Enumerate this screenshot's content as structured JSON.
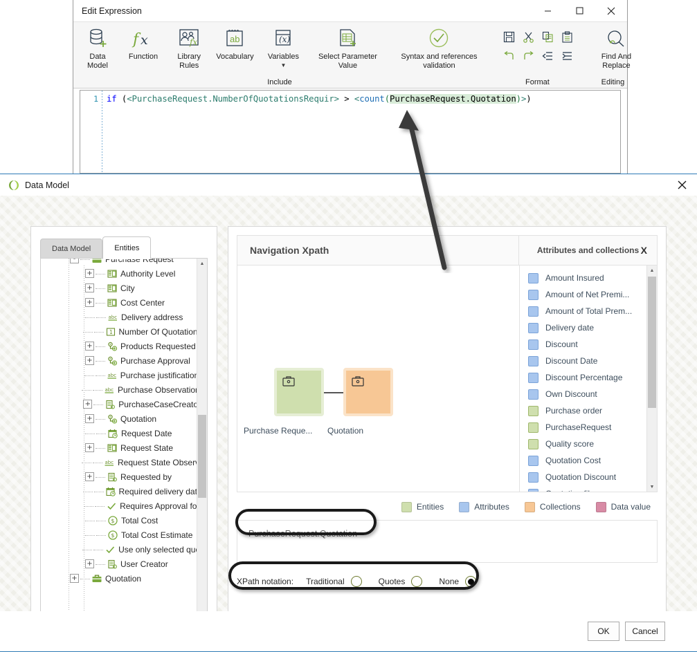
{
  "edit_expression": {
    "title": "Edit Expression",
    "window_buttons": [
      {
        "name": "minimize",
        "glyph": "─"
      },
      {
        "name": "maximize",
        "glyph": "☐"
      },
      {
        "name": "close",
        "glyph": "✕"
      }
    ],
    "ribbon": {
      "include_group_label": "Include",
      "format_group_label": "Format",
      "editing_group_label": "Editing",
      "buttons": [
        {
          "label": "Data\nModel",
          "icon": "database-add-icon"
        },
        {
          "label": "Function",
          "icon": "fx-icon"
        },
        {
          "label": "Library\nRules",
          "icon": "library-rules-icon"
        },
        {
          "label": "Vocabulary",
          "icon": "vocabulary-ab-icon"
        },
        {
          "label": "Variables",
          "icon": "variables-x-icon"
        },
        {
          "label": "Select Parameter\nValue",
          "icon": "select-parameter-icon"
        },
        {
          "label": "Syntax and references\nvalidation",
          "icon": "check-circle-icon"
        }
      ],
      "format_buttons": [
        {
          "name": "save-icon"
        },
        {
          "name": "cut-icon"
        },
        {
          "name": "copy-icon"
        },
        {
          "name": "paste-icon"
        },
        {
          "name": "undo-icon"
        },
        {
          "name": "redo-icon"
        },
        {
          "name": "outdent-icon"
        },
        {
          "name": "indent-icon"
        }
      ],
      "find_replace_label": "Find And\nReplace"
    },
    "editor": {
      "line_number": "1",
      "code_tokens": [
        {
          "text": "if",
          "type": "keyword"
        },
        {
          "text": " (",
          "type": "plain"
        },
        {
          "text": "<PurchaseRequest.NumberOfQuotationsRequir>",
          "type": "entity"
        },
        {
          "text": " > ",
          "type": "plain"
        },
        {
          "text": "<",
          "type": "entity"
        },
        {
          "text": "count",
          "type": "function"
        },
        {
          "text": "(",
          "type": "paren"
        },
        {
          "text": "PurchaseRequest.Quotation",
          "type": "selected"
        },
        {
          "text": ")",
          "type": "paren"
        },
        {
          "text": ">",
          "type": "entity"
        },
        {
          "text": ")",
          "type": "plain"
        }
      ],
      "full_code": "if (<PurchaseRequest.NumberOfQuotationsRequir> > <count(PurchaseRequest.Quotation)>)"
    }
  },
  "data_model": {
    "title": "Data Model",
    "close_glyph": "✕",
    "tabs": [
      {
        "label": "Data Model",
        "active": false
      },
      {
        "label": "Entities",
        "active": true
      }
    ],
    "tree": [
      {
        "label": "Purchase Request",
        "depth": 1,
        "expander": "-",
        "icon": "entity-icon"
      },
      {
        "label": "Authority Level",
        "depth": 2,
        "expander": "+",
        "icon": "list-icon"
      },
      {
        "label": "City",
        "depth": 2,
        "expander": "+",
        "icon": "list-icon"
      },
      {
        "label": "Cost Center",
        "depth": 2,
        "expander": "+",
        "icon": "list-icon"
      },
      {
        "label": "Delivery address",
        "depth": 2,
        "expander": "",
        "icon": "abc-icon"
      },
      {
        "label": "Number Of Quotations",
        "depth": 2,
        "expander": "",
        "icon": "number-icon"
      },
      {
        "label": "Products Requested",
        "depth": 2,
        "expander": "+",
        "icon": "collection-icon"
      },
      {
        "label": "Purchase Approval",
        "depth": 2,
        "expander": "+",
        "icon": "collection-icon"
      },
      {
        "label": "Purchase justification",
        "depth": 2,
        "expander": "",
        "icon": "abc-icon"
      },
      {
        "label": "Purchase Observations",
        "depth": 2,
        "expander": "",
        "icon": "abc-icon"
      },
      {
        "label": "PurchaseCaseCreator",
        "depth": 2,
        "expander": "+",
        "icon": "record-icon"
      },
      {
        "label": "Quotation",
        "depth": 2,
        "expander": "+",
        "icon": "collection-icon"
      },
      {
        "label": "Request Date",
        "depth": 2,
        "expander": "",
        "icon": "date-icon"
      },
      {
        "label": "Request State",
        "depth": 2,
        "expander": "+",
        "icon": "list-icon"
      },
      {
        "label": "Request State Observa",
        "depth": 2,
        "expander": "",
        "icon": "abc-icon"
      },
      {
        "label": "Requested by",
        "depth": 2,
        "expander": "+",
        "icon": "record-icon"
      },
      {
        "label": "Required delivery date",
        "depth": 2,
        "expander": "",
        "icon": "date-icon"
      },
      {
        "label": "Requires Approval for",
        "depth": 2,
        "expander": "",
        "icon": "check-icon"
      },
      {
        "label": "Total Cost",
        "depth": 2,
        "expander": "",
        "icon": "currency-icon"
      },
      {
        "label": "Total Cost Estimate",
        "depth": 2,
        "expander": "",
        "icon": "currency-icon"
      },
      {
        "label": "Use only selected quot",
        "depth": 2,
        "expander": "",
        "icon": "check-icon"
      },
      {
        "label": "User Creator",
        "depth": 2,
        "expander": "+",
        "icon": "record-icon"
      },
      {
        "label": "Quotation",
        "depth": 1,
        "expander": "+",
        "icon": "entity-icon"
      }
    ],
    "navigation": {
      "title": "Navigation Xpath",
      "nodes": [
        {
          "label": "Purchase Reque...",
          "color": "#cfdfae",
          "border": "#e6efd4",
          "type": "entity"
        },
        {
          "label": "Quotation",
          "color": "#f7c795",
          "border": "#fbe0c2",
          "type": "collection"
        }
      ]
    },
    "attributes_panel": {
      "title": "Attributes and collections",
      "close_glyph": "X",
      "items": [
        {
          "label": "Amount Insured",
          "color": "#a8c6ee",
          "kind": "attribute"
        },
        {
          "label": "Amount of Net Premi...",
          "color": "#a8c6ee",
          "kind": "attribute"
        },
        {
          "label": "Amount of Total Prem...",
          "color": "#a8c6ee",
          "kind": "attribute"
        },
        {
          "label": "Delivery date",
          "color": "#a8c6ee",
          "kind": "attribute"
        },
        {
          "label": "Discount",
          "color": "#a8c6ee",
          "kind": "attribute"
        },
        {
          "label": "Discount Date",
          "color": "#a8c6ee",
          "kind": "attribute"
        },
        {
          "label": "Discount Percentage",
          "color": "#a8c6ee",
          "kind": "attribute"
        },
        {
          "label": "Own Discount",
          "color": "#a8c6ee",
          "kind": "attribute"
        },
        {
          "label": "Purchase order",
          "color": "#cfdfae",
          "kind": "entity"
        },
        {
          "label": "PurchaseRequest",
          "color": "#cfdfae",
          "kind": "entity"
        },
        {
          "label": "Quality score",
          "color": "#cfdfae",
          "kind": "entity"
        },
        {
          "label": "Quotation Cost",
          "color": "#a8c6ee",
          "kind": "attribute"
        },
        {
          "label": "Quotation Discount",
          "color": "#a8c6ee",
          "kind": "attribute"
        },
        {
          "label": "Quotation file",
          "color": "#a8c6ee",
          "kind": "attribute"
        }
      ]
    },
    "legend": [
      {
        "label": "Entities",
        "color": "#cfdfae"
      },
      {
        "label": "Attributes",
        "color": "#a8c6ee"
      },
      {
        "label": "Collections",
        "color": "#f7c795"
      },
      {
        "label": "Data value",
        "color": "#d88ba5"
      }
    ],
    "expression_value": "PurchaseRequest.Quotation",
    "xpath_notation": {
      "label": "XPath notation:",
      "options": [
        {
          "label": "Traditional",
          "selected": false
        },
        {
          "label": "Quotes",
          "selected": false
        },
        {
          "label": "None",
          "selected": true
        }
      ]
    },
    "footer": {
      "ok_label": "OK",
      "cancel_label": "Cancel"
    }
  },
  "colors": {
    "accent_blue": "#2d7ab5",
    "entity_green": "#cfdfae",
    "attribute_blue": "#a8c6ee",
    "collection_orange": "#f7c795",
    "data_value_pink": "#d88ba5",
    "icon_green": "#7aa93c"
  }
}
